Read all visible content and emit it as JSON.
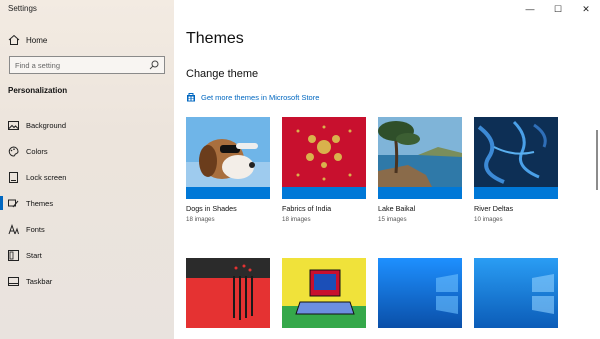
{
  "window": {
    "title": "Settings"
  },
  "window_controls": {
    "minimize": "—",
    "maximize": "☐",
    "close": "✕"
  },
  "sidebar": {
    "home_label": "Home",
    "search_placeholder": "Find a setting",
    "section_title": "Personalization",
    "items": [
      {
        "label": "Background",
        "icon": "image-icon"
      },
      {
        "label": "Colors",
        "icon": "palette-icon"
      },
      {
        "label": "Lock screen",
        "icon": "lock-screen-icon"
      },
      {
        "label": "Themes",
        "icon": "brush-icon",
        "active": true
      },
      {
        "label": "Fonts",
        "icon": "font-icon"
      },
      {
        "label": "Start",
        "icon": "start-icon"
      },
      {
        "label": "Taskbar",
        "icon": "taskbar-icon"
      }
    ]
  },
  "main": {
    "title": "Themes",
    "subtitle": "Change theme",
    "store_link": "Get more themes in Microsoft Store",
    "themes": [
      {
        "name": "Dogs in Shades",
        "count": "18 images"
      },
      {
        "name": "Fabrics of India",
        "count": "18 images"
      },
      {
        "name": "Lake Baikal",
        "count": "15 images"
      },
      {
        "name": "River Deltas",
        "count": "10 images"
      },
      {
        "name": "",
        "count": ""
      },
      {
        "name": "",
        "count": ""
      },
      {
        "name": "",
        "count": ""
      },
      {
        "name": "",
        "count": ""
      }
    ]
  },
  "colors": {
    "accent": "#0078d7",
    "link": "#0067c0"
  }
}
